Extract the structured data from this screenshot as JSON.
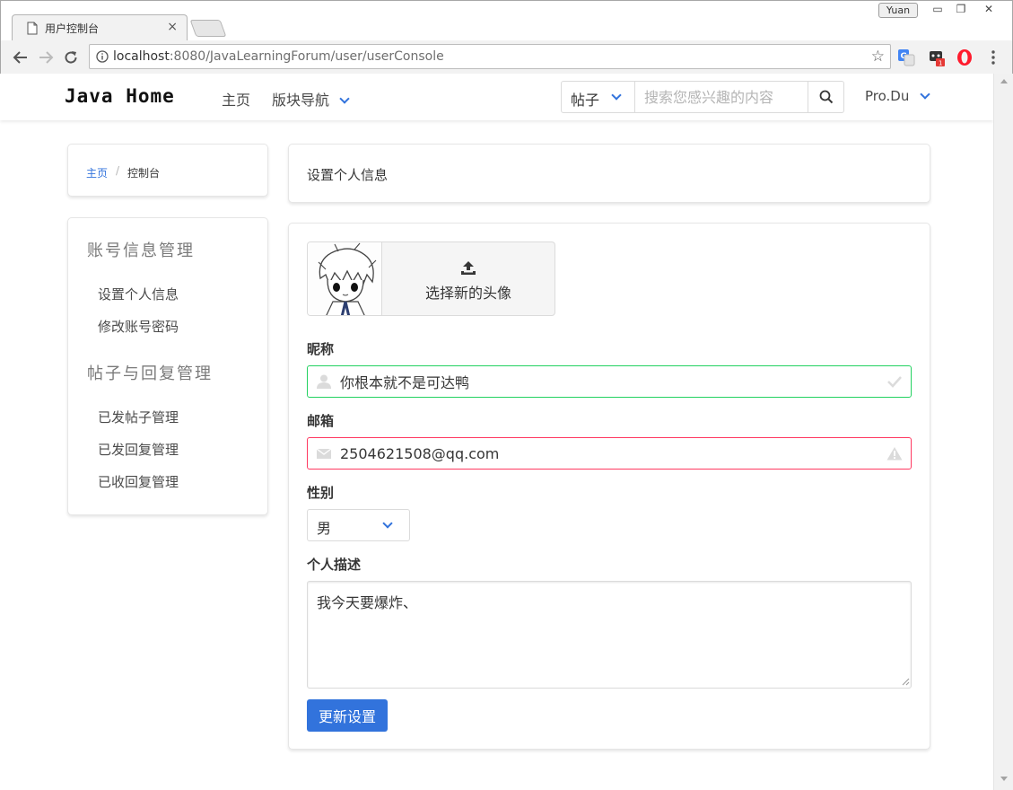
{
  "browser": {
    "tab_title": "用户控制台",
    "tab_close": "×",
    "user_badge": "Yuan",
    "window_buttons": {
      "minimize": "▭",
      "restore": "❐",
      "close": "✕"
    },
    "url_host": "localhost",
    "url_path": ":8080/JavaLearningForum/user/userConsole",
    "extension_badge": "1"
  },
  "site_nav": {
    "brand": "Java Home",
    "home": "主页",
    "sections": "版块导航",
    "search_scope": "帖子",
    "search_placeholder": "搜索您感兴趣的内容",
    "user": "Pro.Du"
  },
  "breadcrumb": {
    "home": "主页",
    "separator": "/",
    "current": "控制台"
  },
  "sidebar": {
    "groups": [
      {
        "label": "账号信息管理",
        "items": [
          "设置个人信息",
          "修改账号密码"
        ]
      },
      {
        "label": "帖子与回复管理",
        "items": [
          "已发帖子管理",
          "已发回复管理",
          "已收回复管理"
        ]
      }
    ]
  },
  "main": {
    "heading": "设置个人信息",
    "upload_label": "选择新的头像",
    "nickname_label": "昵称",
    "nickname_value": "你根本就不是可达鸭",
    "email_label": "邮箱",
    "email_value": "2504621508@qq.com",
    "gender_label": "性别",
    "gender_value": "男",
    "bio_label": "个人描述",
    "bio_value": "我今天要爆炸、",
    "submit_label": "更新设置"
  },
  "colors": {
    "primary": "#3273dc",
    "success": "#23d160",
    "danger": "#ff3860"
  }
}
